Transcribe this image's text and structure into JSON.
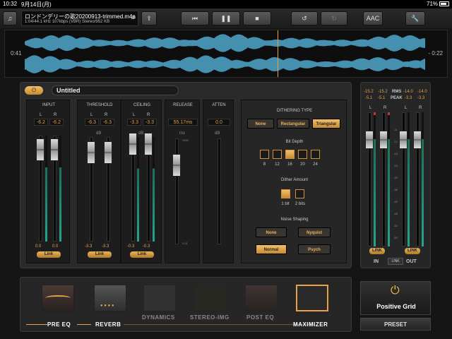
{
  "status": {
    "time": "10:32",
    "date": "9月14日(月)",
    "battery": "71%"
  },
  "file": {
    "name": "ロンドンデリーの歌20200913-trimmed.m4a",
    "meta": "1:04/44.1 kHz 107kbps (VBR) Stereo/952 KB"
  },
  "toolbar": {
    "format_label": "AAC"
  },
  "waveform": {
    "time_left": "0:41",
    "time_right": "- 0:22",
    "playhead_fraction": 0.63
  },
  "preset": {
    "name": "Untitled"
  },
  "input": {
    "label": "INPUT",
    "ch_l": "L",
    "ch_r": "R",
    "left": "-6.2",
    "right": "-6.2",
    "out_l": "0.0",
    "out_r": "0.0",
    "link": "Link"
  },
  "threshold": {
    "label": "THRESHOLD",
    "ch_l": "L",
    "ch_r": "R",
    "left": "-6.3",
    "right": "-6.3",
    "out_l": "-3.3",
    "out_r": "-3.3",
    "db": "dB",
    "link": "Link"
  },
  "ceiling": {
    "label": "CEILING",
    "ch_l": "L",
    "ch_r": "R",
    "left": "-3.3",
    "right": "-3.3",
    "out_l": "-0.3",
    "out_r": "-0.3",
    "db": "dB",
    "link": "Link"
  },
  "release": {
    "label": "RELEASE",
    "value": "55.17ms",
    "unit": "ms",
    "scale_top": "1000",
    "scale_bottom": "0.01"
  },
  "atten": {
    "label": "ATTEN",
    "value": "0.0",
    "unit": "dB"
  },
  "dithering": {
    "type_label": "DITHERING TYPE",
    "types": [
      "None",
      "Rectangular",
      "Triangular"
    ],
    "type_selected": 2,
    "bitdepth_label": "Bit Depth",
    "bitdepths": [
      "8",
      "12",
      "16",
      "20",
      "24"
    ],
    "bitdepth_selected": 2,
    "amount_label": "Dither Amount",
    "amounts": [
      "1 bit",
      "2 bits"
    ],
    "amount_selected": 0,
    "shaping_label": "Noise Shaping",
    "shaping": [
      "None",
      "Nyquist",
      "Normal",
      "Psych"
    ],
    "shaping_selected": 2
  },
  "output_meter": {
    "rms_l": "-15.2",
    "rms_r": "-15.2",
    "rms_label": "RMS",
    "rms_out_l": "-14.0",
    "rms_out_r": "-14.0",
    "peak_l": "-5.1",
    "peak_r": "-5.1",
    "peak_label": "PEAK",
    "peak_out_l": "-3.3",
    "peak_out_r": "-3.3",
    "ch_l": "L",
    "ch_r": "R",
    "in_label": "IN",
    "out_label": "OUT",
    "link_label": "LINK",
    "scale": [
      "-6",
      "-12",
      "-18",
      "-24",
      "-30",
      "-36",
      "-42",
      "-48",
      "-54",
      "-60"
    ]
  },
  "chain": {
    "modules": [
      "PRE EQ",
      "REVERB",
      "DYNAMICS",
      "STEREO-IMG",
      "POST EQ",
      "MAXIMIZER"
    ]
  },
  "brand": {
    "name": "Positive Grid",
    "preset_button": "PRESET"
  },
  "colors": {
    "accent": "#e8a04a",
    "wave": "#5fc8f5",
    "meter": "#23a58a"
  }
}
